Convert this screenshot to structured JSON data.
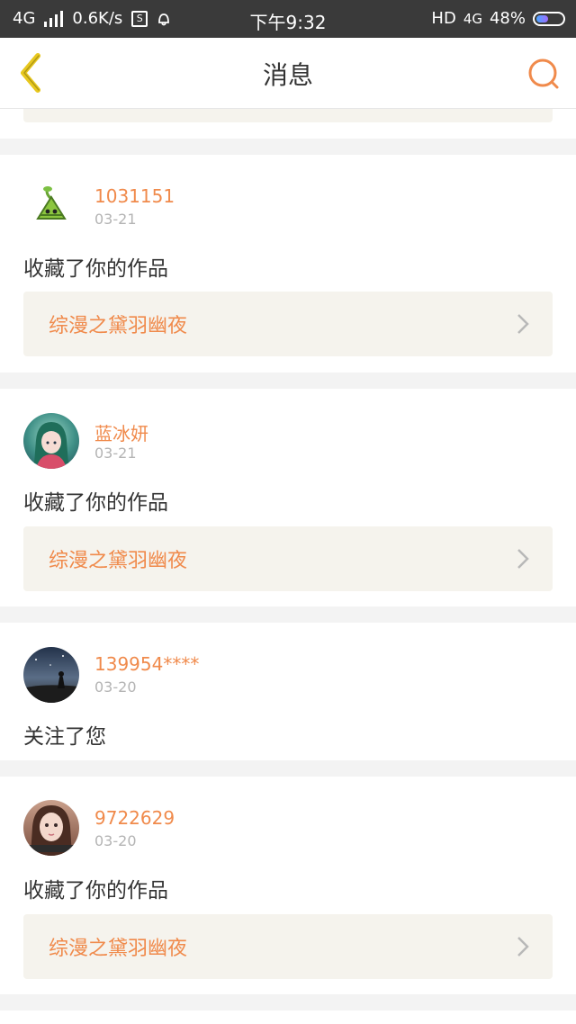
{
  "status_bar": {
    "network": "4G",
    "speed": "0.6K/s",
    "sim_icon_text": "S",
    "time": "下午9:32",
    "hd": "HD",
    "network2": "4G",
    "battery": "48%",
    "battery_level": 0.48
  },
  "header": {
    "title": "消息"
  },
  "messages": [
    {
      "user": "1031151",
      "date": "03-21",
      "action": "收藏了你的作品",
      "work_title": "综漫之黛羽幽夜",
      "avatar": "zongzi-avatar"
    },
    {
      "user": "蓝冰妍",
      "date": "03-21",
      "action": "收藏了你的作品",
      "work_title": "综漫之黛羽幽夜",
      "avatar": "anime-girl-avatar"
    },
    {
      "user": "139954****",
      "date": "03-20",
      "action": "关注了您",
      "work_title": null,
      "avatar": "night-sky-avatar"
    },
    {
      "user": "9722629",
      "date": "03-20",
      "action": "收藏了你的作品",
      "work_title": "综漫之黛羽幽夜",
      "avatar": "doll-avatar"
    }
  ],
  "colors": {
    "accent": "#f08a4b",
    "back_icon": "#e8c81f",
    "statusbar": "#3a3a3a",
    "card_bg": "#ffffff",
    "page_bg": "#f3f3f3",
    "work_bg": "#f5f3ed"
  }
}
